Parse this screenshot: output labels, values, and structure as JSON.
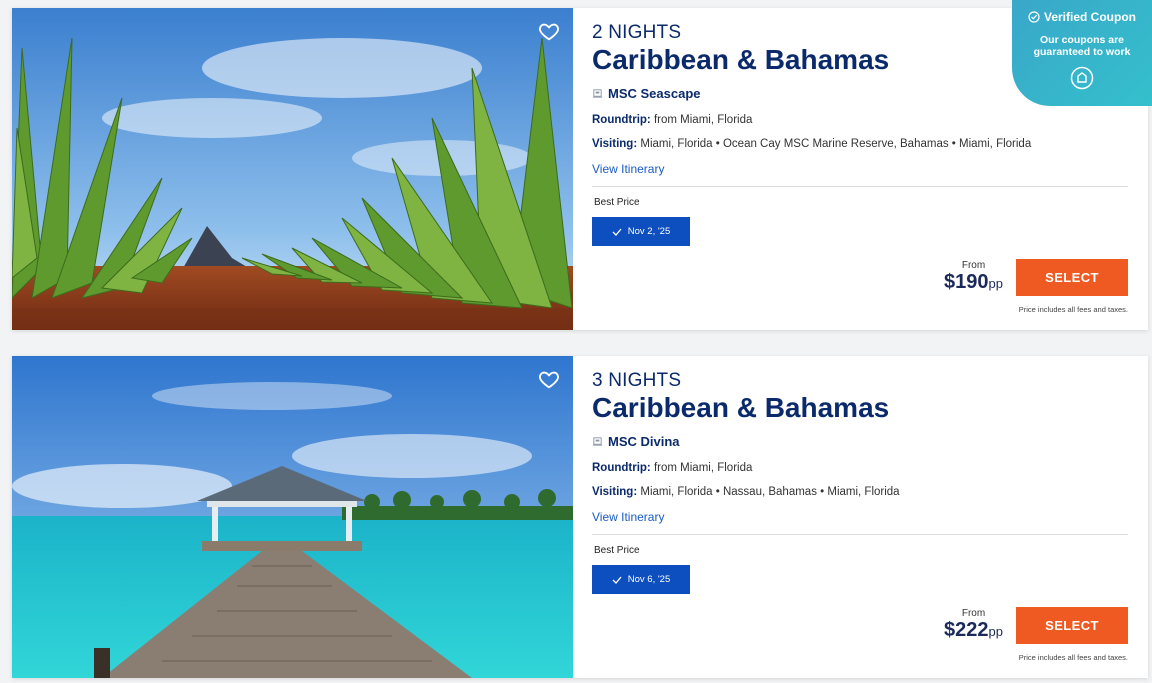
{
  "cruises": [
    {
      "nights": "2 NIGHTS",
      "destination": "Caribbean & Bahamas",
      "ship": "MSC Seascape",
      "roundtrip_label": "Roundtrip:",
      "roundtrip_value": "from Miami, Florida",
      "visiting_label": "Visiting:",
      "visiting_value": "Miami, Florida • Ocean Cay MSC Marine Reserve, Bahamas • Miami, Florida",
      "itinerary_link": "View Itinerary",
      "best_price_label": "Best Price",
      "date": "Nov 2, '25",
      "from_label": "From",
      "price": "$190",
      "price_suffix": "pp",
      "select_label": "SELECT",
      "fees_note": "Price includes all fees and taxes.",
      "image": "aloe-vera-field"
    },
    {
      "nights": "3 NIGHTS",
      "destination": "Caribbean & Bahamas",
      "ship": "MSC Divina",
      "roundtrip_label": "Roundtrip:",
      "roundtrip_value": "from Miami, Florida",
      "visiting_label": "Visiting:",
      "visiting_value": "Miami, Florida • Nassau, Bahamas • Miami, Florida",
      "itinerary_link": "View Itinerary",
      "best_price_label": "Best Price",
      "date": "Nov 6, '25",
      "from_label": "From",
      "price": "$222",
      "price_suffix": "pp",
      "select_label": "SELECT",
      "fees_note": "Price includes all fees and taxes.",
      "image": "tropical-pier"
    }
  ],
  "coupon": {
    "title": "Verified Coupon",
    "text": "Our coupons are guaranteed to work",
    "icon": "coupon-tag-icon"
  },
  "colors": {
    "navy": "#0b2a6b",
    "date_button": "#0e4fbf",
    "select_button": "#ef5a22",
    "coupon_bg": "#3aa7c9"
  }
}
